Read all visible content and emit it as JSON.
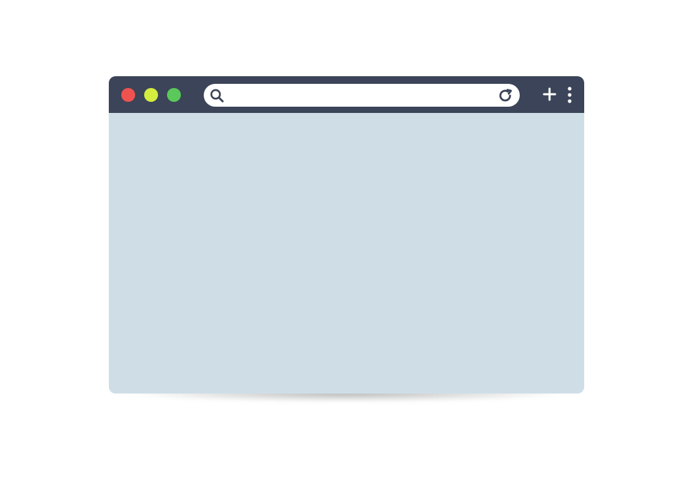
{
  "browser": {
    "window_controls": [
      {
        "name": "close",
        "color": "#ef5350"
      },
      {
        "name": "minimize",
        "color": "#d4ec3f"
      },
      {
        "name": "maximize",
        "color": "#5ac85a"
      }
    ],
    "address_bar": {
      "value": "",
      "placeholder": ""
    },
    "icons": {
      "search": "search-icon",
      "reload": "reload-icon",
      "new_tab": "plus-icon",
      "menu": "kebab-menu-icon"
    },
    "colors": {
      "titlebar": "#3b4458",
      "content": "#cfdee6",
      "address_bar": "#ffffff"
    }
  }
}
